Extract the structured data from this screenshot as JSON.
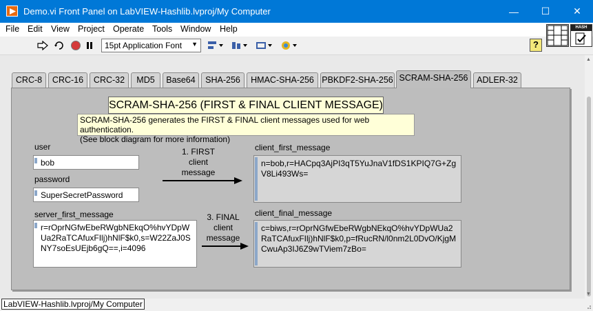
{
  "window": {
    "title": "Demo.vi Front Panel on LabVIEW-Hashlib.lvproj/My Computer",
    "minimize": "—",
    "maximize": "☐",
    "close": "✕"
  },
  "menu": {
    "items": [
      "File",
      "Edit",
      "View",
      "Project",
      "Operate",
      "Tools",
      "Window",
      "Help"
    ]
  },
  "toolbar": {
    "font": "15pt Application Font",
    "help": "?",
    "vi_icon_label": "HASH"
  },
  "tabs": [
    "CRC-8",
    "CRC-16",
    "CRC-32",
    "MD5",
    "Base64",
    "SHA-256",
    "HMAC-SHA-256",
    "PBKDF2-SHA-256",
    "SCRAM-SHA-256",
    "ADLER-32"
  ],
  "active_tab": "SCRAM-SHA-256",
  "panel": {
    "heading": "SCRAM-SHA-256 (FIRST & FINAL CLIENT MESSAGE)",
    "description_line1": "SCRAM-SHA-256 generates the FIRST & FINAL client messages used for web authentication.",
    "description_line2": "(See block diagram for more information)",
    "user_label": "user",
    "user_value": "bob",
    "password_label": "password",
    "password_value": "SuperSecretPassword",
    "server_first_label": "server_first_message",
    "server_first_value": "r=rOprNGfwEbeRWgbNEkqO%hvYDpWUa2RaTCAfuxFIlj)hNlF$k0,s=W22ZaJ0SNY7soEsUEjb6gQ==,i=4096",
    "step1_line1": "1. FIRST",
    "step1_line2": "client",
    "step1_line3": "message",
    "step3_line1": "3. FINAL",
    "step3_line2": "client",
    "step3_line3": "message",
    "client_first_label": "client_first_message",
    "client_first_value": "n=bob,r=HACpq3AjPI3qT5YuJnaV1fDS1KPIQ7G+ZgV8Li493Ws=",
    "client_final_label": "client_final_message",
    "client_final_value": "c=biws,r=rOprNGfwEbeRWgbNEkqO%hvYDpWUa2RaTCAfuxFIlj)hNlF$k0,p=fRucRN/l0nm2L0DvO/KjgMCwuAp3IJ6Z9wTViem7zBo="
  },
  "statusbar": {
    "path": "LabVIEW-Hashlib.lvproj/My Computer"
  }
}
